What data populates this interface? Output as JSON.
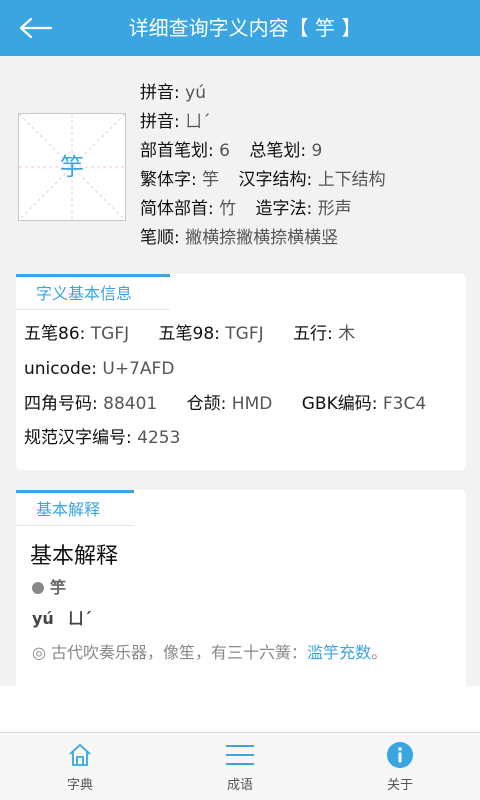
{
  "header": {
    "title": "详细查询字义内容【 竽 】"
  },
  "char": "竽",
  "info": {
    "pinyin_label": "拼音:",
    "pinyin": "yú",
    "zhuyin_label": "拼音:",
    "zhuyin": "ㄩˊ",
    "bushou_bihua_label": "部首笔划:",
    "bushou_bihua": "6",
    "zong_bihua_label": "总笔划:",
    "zong_bihua": "9",
    "fanti_label": "繁体字:",
    "fanti": "竽",
    "jiegou_label": "汉字结构:",
    "jiegou": "上下结构",
    "jianti_bushou_label": "简体部首:",
    "jianti_bushou": "竹",
    "zaozifa_label": "造字法:",
    "zaozifa": "形声",
    "bishun_label": "笔顺:",
    "bishun": "撇横捺撇横捺横横竖"
  },
  "basic_info": {
    "tab": "字义基本信息",
    "wubi86_label": "五笔86:",
    "wubi86": "TGFJ",
    "wubi98_label": "五笔98:",
    "wubi98": "TGFJ",
    "wuxing_label": "五行:",
    "wuxing": "木",
    "unicode_label": "unicode:",
    "unicode": "U+7AFD",
    "sijiao_label": "四角号码:",
    "sijiao": "88401",
    "cangjie_label": "仓颉:",
    "cangjie": "HMD",
    "gbk_label": "GBK编码:",
    "gbk": "F3C4",
    "guifan_label": "规范汉字编号:",
    "guifan": "4253"
  },
  "explain": {
    "tab": "基本解释",
    "title": "基本解释",
    "bullet": "竽",
    "pinyin": "yú",
    "zhuyin": "ㄩˊ",
    "def_text": "◎ 古代吹奏乐器，像笙，有三十六簧：",
    "def_link": "滥竽充数",
    "def_end": "。"
  },
  "nav": {
    "items": [
      {
        "label": "字典",
        "icon": "home-icon"
      },
      {
        "label": "成语",
        "icon": "menu-icon"
      },
      {
        "label": "关于",
        "icon": "info-icon"
      }
    ]
  },
  "colors": {
    "accent": "#3aa5e0"
  }
}
